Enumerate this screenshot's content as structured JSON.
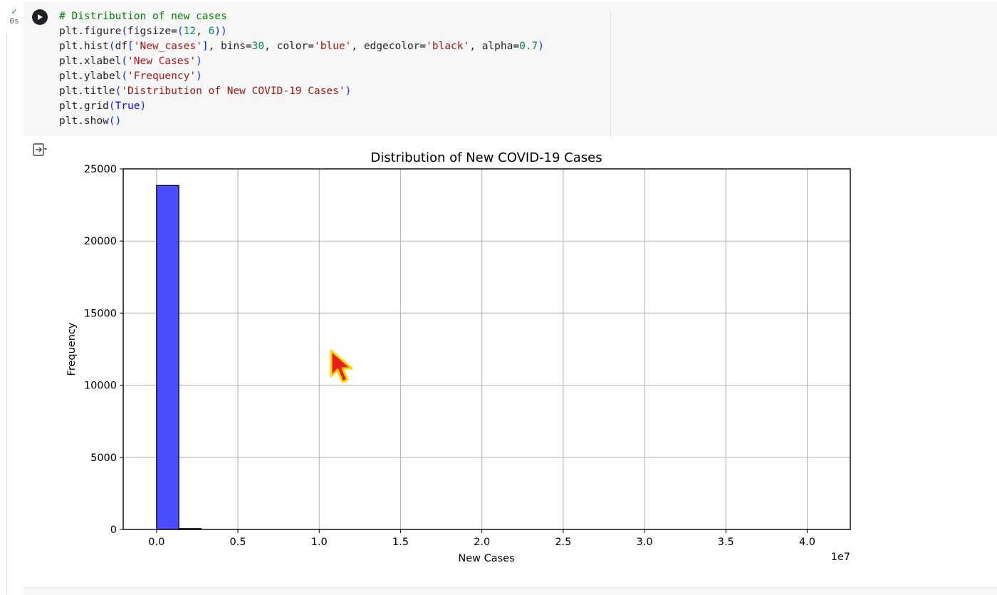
{
  "cell": {
    "status_check": "✓",
    "status_time": "0s",
    "code_lines": [
      [
        {
          "t": "# Distribution of new cases",
          "c": "c-com"
        }
      ],
      [
        {
          "t": "plt.figure",
          "c": ""
        },
        {
          "t": "(",
          "c": "c-par"
        },
        {
          "t": "figsize=",
          "c": ""
        },
        {
          "t": "(",
          "c": "c-par"
        },
        {
          "t": "12",
          "c": "c-num"
        },
        {
          "t": ", ",
          "c": ""
        },
        {
          "t": "6",
          "c": "c-num"
        },
        {
          "t": "))",
          "c": "c-par"
        }
      ],
      [
        {
          "t": "plt.hist",
          "c": ""
        },
        {
          "t": "(",
          "c": "c-par"
        },
        {
          "t": "df",
          "c": ""
        },
        {
          "t": "[",
          "c": "c-par"
        },
        {
          "t": "'New_cases'",
          "c": "c-str"
        },
        {
          "t": "]",
          "c": "c-par"
        },
        {
          "t": ", bins=",
          "c": ""
        },
        {
          "t": "30",
          "c": "c-num"
        },
        {
          "t": ", color=",
          "c": ""
        },
        {
          "t": "'blue'",
          "c": "c-str"
        },
        {
          "t": ", edgecolor=",
          "c": ""
        },
        {
          "t": "'black'",
          "c": "c-str"
        },
        {
          "t": ", alpha=",
          "c": ""
        },
        {
          "t": "0.7",
          "c": "c-num"
        },
        {
          "t": ")",
          "c": "c-par"
        }
      ],
      [
        {
          "t": "plt.xlabel",
          "c": ""
        },
        {
          "t": "(",
          "c": "c-par"
        },
        {
          "t": "'New Cases'",
          "c": "c-str"
        },
        {
          "t": ")",
          "c": "c-par"
        }
      ],
      [
        {
          "t": "plt.ylabel",
          "c": ""
        },
        {
          "t": "(",
          "c": "c-par"
        },
        {
          "t": "'Frequency'",
          "c": "c-str"
        },
        {
          "t": ")",
          "c": "c-par"
        }
      ],
      [
        {
          "t": "plt.title",
          "c": ""
        },
        {
          "t": "(",
          "c": "c-par"
        },
        {
          "t": "'Distribution of New COVID-19 Cases'",
          "c": "c-str"
        },
        {
          "t": ")",
          "c": "c-par"
        }
      ],
      [
        {
          "t": "plt.grid",
          "c": ""
        },
        {
          "t": "(",
          "c": "c-par"
        },
        {
          "t": "True",
          "c": "c-kw"
        },
        {
          "t": ")",
          "c": "c-par"
        }
      ],
      [
        {
          "t": "plt.show",
          "c": ""
        },
        {
          "t": "()",
          "c": "c-par"
        }
      ]
    ]
  },
  "chart_data": {
    "type": "bar",
    "title": "Distribution of New COVID-19 Cases",
    "xlabel": "New Cases",
    "ylabel": "Frequency",
    "x_offset_label": "1e7",
    "xlim": [
      -2050000,
      42650000
    ],
    "ylim": [
      0,
      25000
    ],
    "xticks": [
      0,
      5000000,
      10000000,
      15000000,
      20000000,
      25000000,
      30000000,
      35000000,
      40000000
    ],
    "xtick_labels": [
      "0.0",
      "0.5",
      "1.0",
      "1.5",
      "2.0",
      "2.5",
      "3.0",
      "3.5",
      "4.0"
    ],
    "yticks": [
      0,
      5000,
      10000,
      15000,
      20000,
      25000
    ],
    "ytick_labels": [
      "0",
      "5000",
      "10000",
      "15000",
      "20000",
      "25000"
    ],
    "grid": true,
    "bar_color": "#4b4bff",
    "edge_color": "#000000",
    "bins": [
      {
        "x0": 0,
        "x1": 1370000,
        "value": 23850
      },
      {
        "x0": 1370000,
        "x1": 2740000,
        "value": 60
      }
    ]
  }
}
